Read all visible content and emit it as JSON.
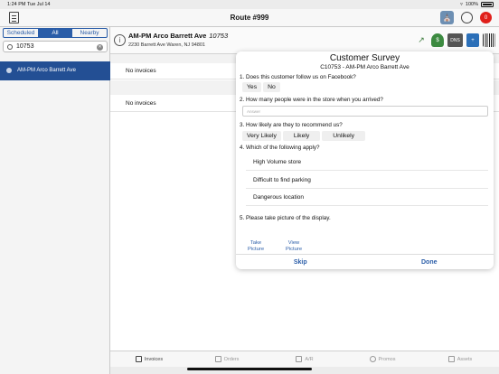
{
  "status_bar": {
    "time": "1:24 PM",
    "date": "Tue Jul 14",
    "battery": "100%"
  },
  "top_bar": {
    "title": "Route #999",
    "badge_count": "0"
  },
  "sidebar": {
    "segments": [
      "Scheduled",
      "All",
      "Nearby"
    ],
    "active_segment": "All",
    "search_value": "10753",
    "selected_item": "AM-PM Arco   Barrett Ave"
  },
  "customer": {
    "name": "AM-PM Arco   Barrett Ave",
    "number": "10753",
    "address": "2230 Barrett Ave Waren, NJ 94801"
  },
  "toolbar": {
    "dns_label": "DNS"
  },
  "content": {
    "rows": [
      "No invoices",
      "No invoices"
    ]
  },
  "survey": {
    "title": "Customer Survey",
    "subtitle": "C10753 - AM-PM Arco   Barrett Ave",
    "q1": "1. Does this customer follow us on Facebook?",
    "q1_options": [
      "Yes",
      "No"
    ],
    "q2": "2. How many people were in the store when you arrived?",
    "q2_placeholder": "Answer",
    "q3": "3. How likely are they to recommend us?",
    "q3_options": [
      "Very Likely",
      "Likely",
      "Unlikely"
    ],
    "q4": "4. Which of the following apply?",
    "q4_choices": [
      "High Volume store",
      "Difficult to find parking",
      "Dangerous location"
    ],
    "q5": "5. Please take picture of the display.",
    "take_picture": [
      "Take",
      "Picture"
    ],
    "view_picture": [
      "View",
      "Picture"
    ],
    "skip": "Skip",
    "done": "Done"
  },
  "tabs": [
    {
      "label": "Invoices",
      "icon": "invoices-icon",
      "active": true
    },
    {
      "label": "Orders",
      "icon": "orders-icon",
      "active": false
    },
    {
      "label": "A/R",
      "icon": "ar-icon",
      "active": false
    },
    {
      "label": "Promos",
      "icon": "promos-icon",
      "active": false
    },
    {
      "label": "Assets",
      "icon": "assets-icon",
      "active": false
    }
  ],
  "colors": {
    "accent": "#2a5da8",
    "selected_row": "#234f94",
    "badge": "#e0201b"
  }
}
